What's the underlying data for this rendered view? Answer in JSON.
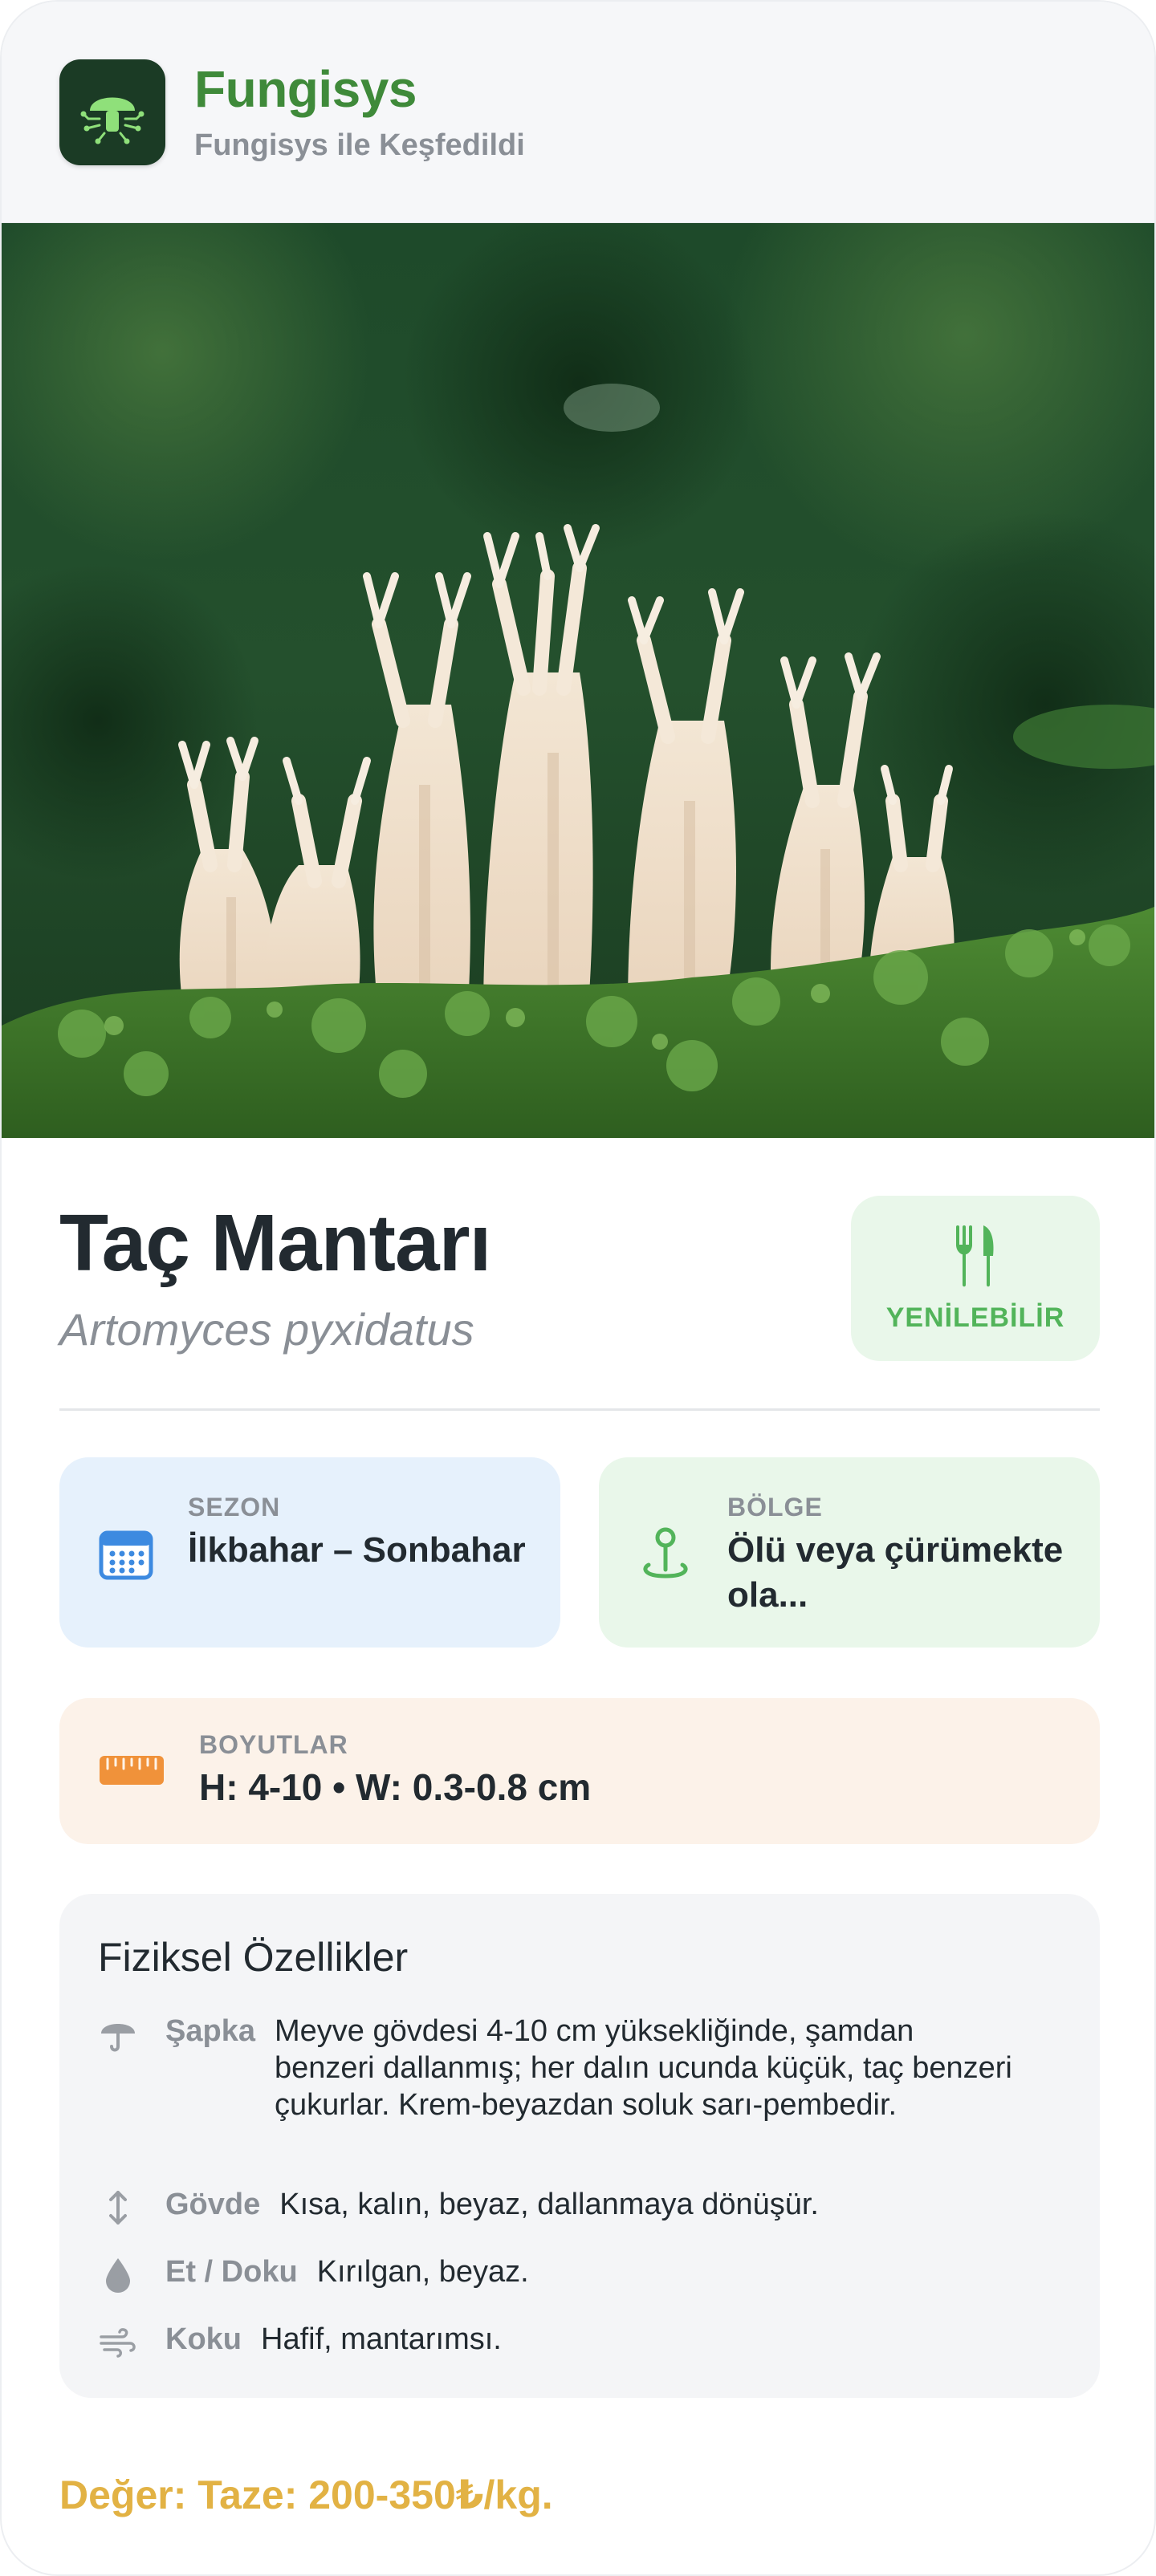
{
  "header": {
    "app_name": "Fungisys",
    "subtitle": "Fungisys ile Keşfedildi",
    "logo_icon": "mushroom-icon"
  },
  "hero": {
    "image_icon": "coral-mushroom-photo"
  },
  "species": {
    "common_name": "Taç Mantarı",
    "scientific_name": "Artomyces pyxidatus",
    "edibility": "YENİLEBİLİR",
    "edibility_icon": "fork-knife-icon"
  },
  "info": {
    "season": {
      "label": "SEZON",
      "value": "İlkbahar – Sonbahar",
      "icon": "calendar-icon"
    },
    "region": {
      "label": "BÖLGE",
      "value": "Ölü veya çürümekte ola...",
      "icon": "location-pin-icon"
    },
    "dimensions": {
      "label": "BOYUTLAR",
      "value": "H: 4-10 • W: 0.3-0.8 cm",
      "icon": "ruler-icon"
    }
  },
  "features": {
    "title": "Fiziksel Özellikler",
    "items": [
      {
        "key": "Şapka",
        "value": "Meyve gövdesi 4-10 cm yüksekliğinde, şamdan benzeri dallanmış; her dalın ucunda küçük, taç benzeri çukurlar. Krem-beyazdan soluk sarı-pembedir.",
        "icon": "umbrella-icon"
      },
      {
        "key": "Gövde",
        "value": "Kısa, kalın, beyaz, dallanmaya dönüşür.",
        "icon": "vertical-arrows-icon"
      },
      {
        "key": "Et / Doku",
        "value": "Kırılgan, beyaz.",
        "icon": "drop-icon"
      },
      {
        "key": "Koku",
        "value": "Hafif, mantarımsı.",
        "icon": "wind-icon"
      }
    ]
  },
  "price": "Değer: Taze: 200-350₺/kg.",
  "colors": {
    "brand_green": "#3f8a3a",
    "edible_green": "#52b45a",
    "season_bg": "#e6f1fc",
    "region_bg": "#e9f7ea",
    "dims_bg": "#fcf2e9",
    "price_gold": "#e2b244"
  }
}
